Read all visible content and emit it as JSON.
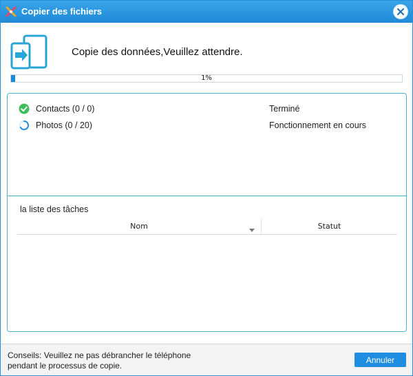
{
  "window": {
    "title": "Copier des fichiers",
    "accent_color": "#1f8ad8"
  },
  "header": {
    "message": "Copie des données,Veuillez attendre.",
    "icon": "phone-transfer-icon"
  },
  "progress": {
    "value": 0.01,
    "label": "1%"
  },
  "tasks": [
    {
      "label": "Contacts (0 / 0)",
      "status": "Terminé",
      "icon": "check-circle-icon",
      "icon_color": "#3cbf5a"
    },
    {
      "label": "Photos (0 / 20)",
      "status": "Fonctionnement en cours",
      "icon": "spinner-icon",
      "icon_color": "#1f8ee0"
    }
  ],
  "task_list": {
    "title": "la liste des tâches",
    "columns": [
      "Nom",
      "Statut"
    ],
    "rows": []
  },
  "footer": {
    "hint_line1": "Conseils: Veuillez ne pas débrancher le téléphone",
    "hint_line2": "pendant le processus de copie.",
    "cancel_label": "Annuler"
  }
}
